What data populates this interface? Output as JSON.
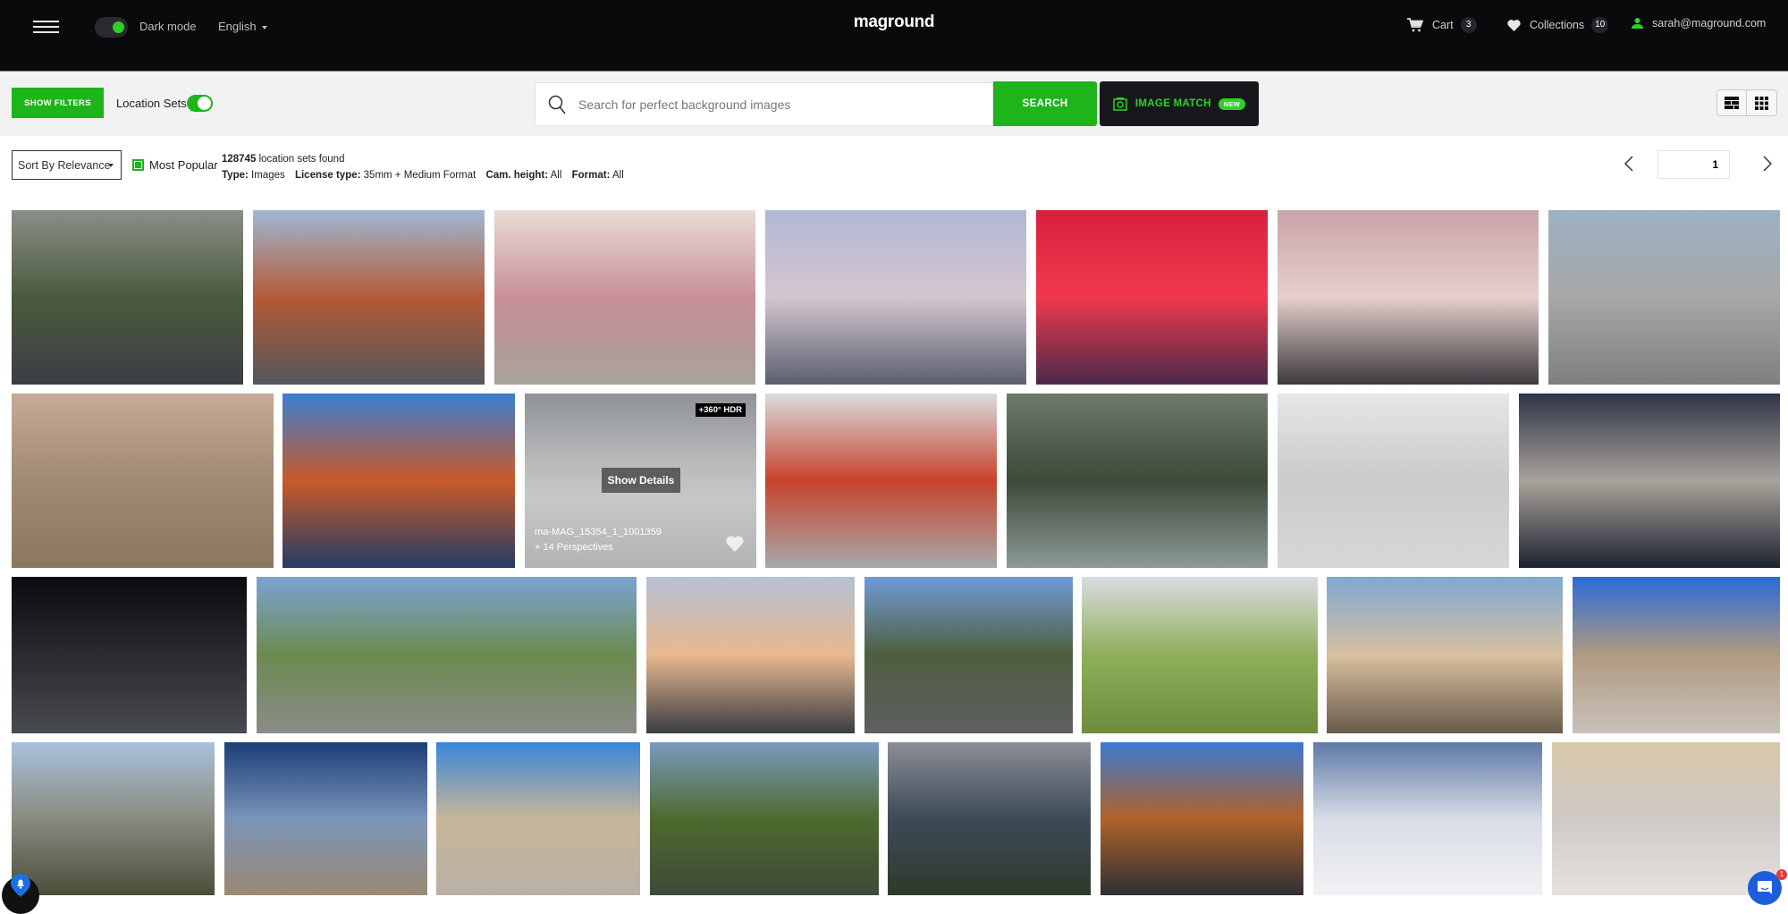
{
  "header": {
    "dark_mode_label": "Dark mode",
    "dark_mode_on": true,
    "language": "English",
    "logo": "maground",
    "cart_label": "Cart",
    "cart_count": "3",
    "collections_label": "Collections",
    "collections_count": "10",
    "user_email": "sarah@maground.com"
  },
  "toolbar": {
    "show_filters_label": "SHOW FILTERS",
    "location_sets_label": "Location Sets",
    "location_sets_on": true,
    "search_placeholder": "Search for perfect background images",
    "search_value": "",
    "search_button": "SEARCH",
    "image_match_label": "IMAGE MATCH",
    "image_match_badge": "NEW",
    "view_modes": [
      "masonry-view",
      "grid-view"
    ]
  },
  "results": {
    "sort_selected": "Sort By Relevance",
    "most_popular_label": "Most Popular",
    "most_popular_checked": true,
    "count": "128745",
    "count_suffix": " location sets found",
    "filters": [
      {
        "key": "Type:",
        "value": "Images"
      },
      {
        "key": "License type:",
        "value": "35mm + Medium Format"
      },
      {
        "key": "Cam. height:",
        "value": "All"
      },
      {
        "key": "Format:",
        "value": "All"
      }
    ],
    "page": "1"
  },
  "tiles": [
    {
      "desc": "modern building street with yellow lines",
      "colors": [
        "#8a8f86",
        "#4b5a3e",
        "#3c3e44"
      ]
    },
    {
      "desc": "orange parking ramp with arrow",
      "colors": [
        "#9fb8d6",
        "#b55a36",
        "#54565c"
      ]
    },
    {
      "desc": "white sand desert road at dusk",
      "colors": [
        "#e8dcd2",
        "#c88f9a",
        "#a8a29c"
      ]
    },
    {
      "desc": "snowy road under pink sky",
      "colors": [
        "#b0b8d4",
        "#d4c6d0",
        "#5b5f70"
      ]
    },
    {
      "desc": "red illuminated hall",
      "colors": [
        "#d9213e",
        "#f0384e",
        "#4a2a48"
      ]
    },
    {
      "desc": "perforated building crosswalk",
      "colors": [
        "#c9a4a8",
        "#e5cfcc",
        "#3d3a3f"
      ]
    },
    {
      "desc": "parking garage street",
      "colors": [
        "#9db0c7",
        "#a6a8a6",
        "#7e7f7f"
      ]
    },
    {
      "desc": "desert rock formations at dusk",
      "colors": [
        "#c7aa98",
        "#a08a73",
        "#8b7760"
      ]
    },
    {
      "desc": "blue rooftop with orange wall",
      "colors": [
        "#3b7fd2",
        "#c95a2a",
        "#243c66"
      ]
    },
    {
      "desc": "empty warehouse hall",
      "colors": [
        "#9fa2a6",
        "#c2c3c4",
        "#b0b0b0"
      ],
      "hdr": "+360° HDR",
      "hover": true,
      "details_label": "Show Details",
      "name": "ma-MAG_15354_1_1001359",
      "perspectives": "+ 14 Perspectives"
    },
    {
      "desc": "warehouse racks numbered",
      "colors": [
        "#d9dcdf",
        "#c8422c",
        "#a7a9ab"
      ]
    },
    {
      "desc": "forest road curve",
      "colors": [
        "#6e7a6a",
        "#3d4a38",
        "#8c9a9a"
      ]
    },
    {
      "desc": "bright warehouse with yellow line",
      "colors": [
        "#e4e6e8",
        "#c9cbcd",
        "#d5d7d9"
      ]
    },
    {
      "desc": "stair shadows",
      "colors": [
        "#2e3448",
        "#a8a29a",
        "#1e2232"
      ]
    },
    {
      "desc": "dark parking arrows",
      "colors": [
        "#0a0b0e",
        "#2a2b30",
        "#474a50"
      ]
    },
    {
      "desc": "mountain hairpin road",
      "colors": [
        "#7aa4d2",
        "#6c8a50",
        "#8a8c8a"
      ]
    },
    {
      "desc": "road at sunset with pylons",
      "colors": [
        "#b5c0d4",
        "#e8b890",
        "#3a3c42"
      ]
    },
    {
      "desc": "roadside with trees",
      "colors": [
        "#6f9cd8",
        "#4f5e3e",
        "#5e5f62"
      ]
    },
    {
      "desc": "green hills with path",
      "colors": [
        "#dadce2",
        "#8fae5a",
        "#6d8c3c"
      ]
    },
    {
      "desc": "mountains with clouds plateau",
      "colors": [
        "#7fa8d2",
        "#d8c0a0",
        "#6a5a4a"
      ]
    },
    {
      "desc": "desert rocks blue sky",
      "colors": [
        "#2a6ad8",
        "#b09a80",
        "#c8c2ba"
      ]
    },
    {
      "desc": "coastal arch bridge",
      "colors": [
        "#a8c2dc",
        "#8a8a80",
        "#4a4e3a"
      ]
    },
    {
      "desc": "dry lakeshore under blue sky",
      "colors": [
        "#1c3e78",
        "#7a94b8",
        "#9a8a72"
      ]
    },
    {
      "desc": "granite boulders",
      "colors": [
        "#3a86d8",
        "#c8b59a",
        "#b9b1a5"
      ]
    },
    {
      "desc": "modern house garden",
      "colors": [
        "#7a9ac0",
        "#4e6a2e",
        "#3e4a3a"
      ]
    },
    {
      "desc": "modern house glass",
      "colors": [
        "#8a8e96",
        "#3e4a58",
        "#2e3a2a"
      ]
    },
    {
      "desc": "wooden facade building",
      "colors": [
        "#3a7ad0",
        "#b0622a",
        "#2e3034"
      ]
    },
    {
      "desc": "snowy fjord road",
      "colors": [
        "#5e7aa8",
        "#d8dce6",
        "#f2f2f4"
      ]
    },
    {
      "desc": "snowy mountain road",
      "colors": [
        "#d8c8a8",
        "#cfc9c6",
        "#e6e2e0"
      ]
    }
  ],
  "floating": {
    "chat_unread": "1"
  }
}
